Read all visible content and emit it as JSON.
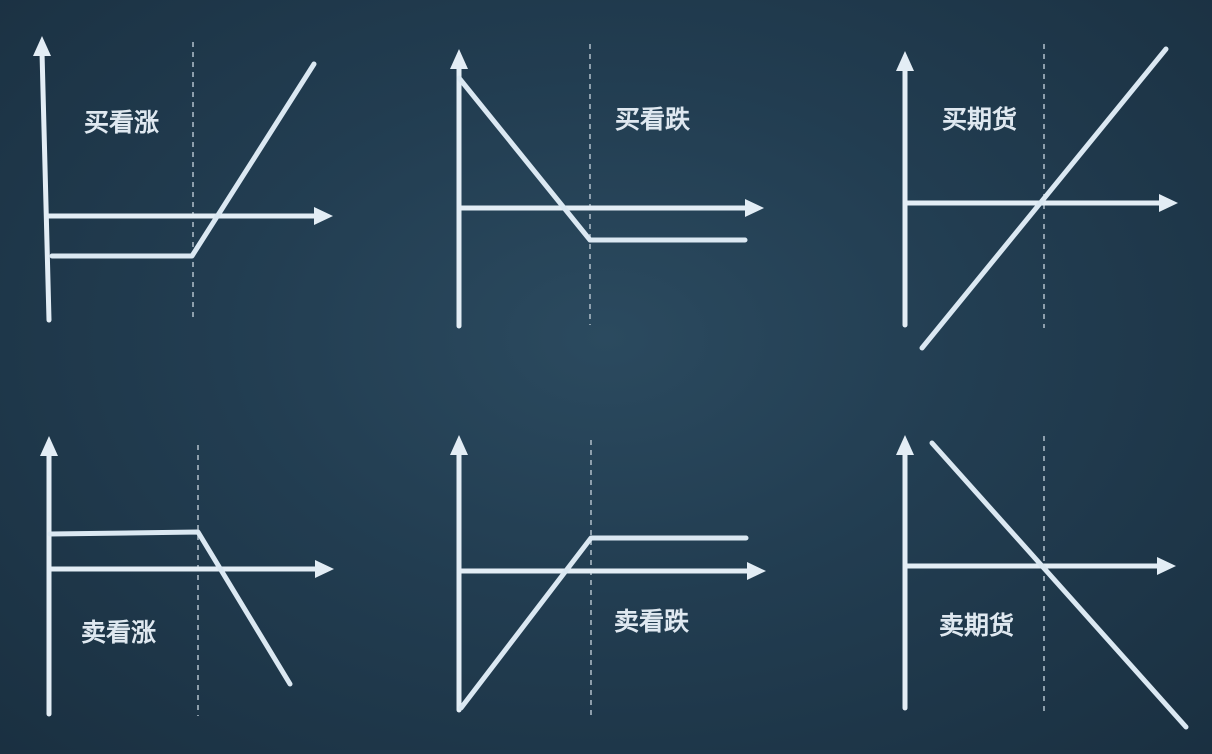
{
  "panels": [
    {
      "id": "buy-call",
      "label": "买看涨"
    },
    {
      "id": "buy-put",
      "label": "买看跌"
    },
    {
      "id": "buy-futures",
      "label": "买期货"
    },
    {
      "id": "sell-call",
      "label": "卖看涨"
    },
    {
      "id": "sell-put",
      "label": "卖看跌"
    },
    {
      "id": "sell-futures",
      "label": "卖期货"
    }
  ],
  "colors": {
    "background": "#223d51",
    "line": "#e3edf5",
    "strike_dashes": "#a9b8c4"
  }
}
